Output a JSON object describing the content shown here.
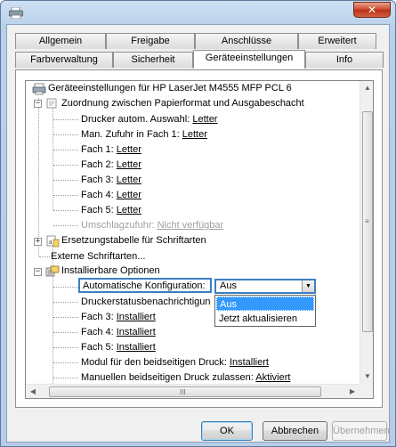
{
  "window": {
    "close_glyph": "✕"
  },
  "tabs": {
    "row1": [
      "Allgemein",
      "Freigabe",
      "Anschlüsse",
      "Erweitert"
    ],
    "row2": [
      "Farbverwaltung",
      "Sicherheit",
      "Geräteeinstellungen",
      "Info"
    ],
    "active": "Geräteeinstellungen"
  },
  "tree": {
    "root": "Geräteeinstellungen für HP LaserJet M4555 MFP PCL 6",
    "section1": "Zuordnung zwischen Papierformat und Ausgabeschacht",
    "items1": [
      {
        "label": "Drucker autom. Auswahl:",
        "value": "Letter"
      },
      {
        "label": "Man. Zufuhr in Fach 1:",
        "value": "Letter"
      },
      {
        "label": "Fach 1:",
        "value": "Letter"
      },
      {
        "label": "Fach 2:",
        "value": "Letter"
      },
      {
        "label": "Fach 3:",
        "value": "Letter"
      },
      {
        "label": "Fach 4:",
        "value": "Letter"
      },
      {
        "label": "Fach 5:",
        "value": "Letter"
      }
    ],
    "envelope": {
      "label": "Umschlagzufuhr:",
      "value": "Nicht verfügbar"
    },
    "section2": "Ersetzungstabelle für Schriftarten",
    "external_fonts": "Externe Schriftarten...",
    "section3": "Installierbare Optionen",
    "auto_config_label": "Automatische Konfiguration:",
    "status_notify": "Druckerstatusbenachrichtigun",
    "items3": [
      {
        "label": "Fach 3:",
        "value": "Installiert"
      },
      {
        "label": "Fach 4:",
        "value": "Installiert"
      },
      {
        "label": "Fach 5:",
        "value": "Installiert"
      },
      {
        "label": "Modul für den beidseitigen Druck:",
        "value": "Installiert"
      },
      {
        "label": "Manuellen beidseitigen Druck zulassen:",
        "value": "Aktiviert"
      }
    ]
  },
  "combo": {
    "value": "Aus",
    "options": [
      "Aus",
      "Jetzt aktualisieren"
    ]
  },
  "scroll": {
    "hthumb_grip": "III",
    "vthumb_grip": "≡"
  },
  "buttons": {
    "ok": "OK",
    "cancel": "Abbrechen",
    "apply": "Übernehmen"
  }
}
